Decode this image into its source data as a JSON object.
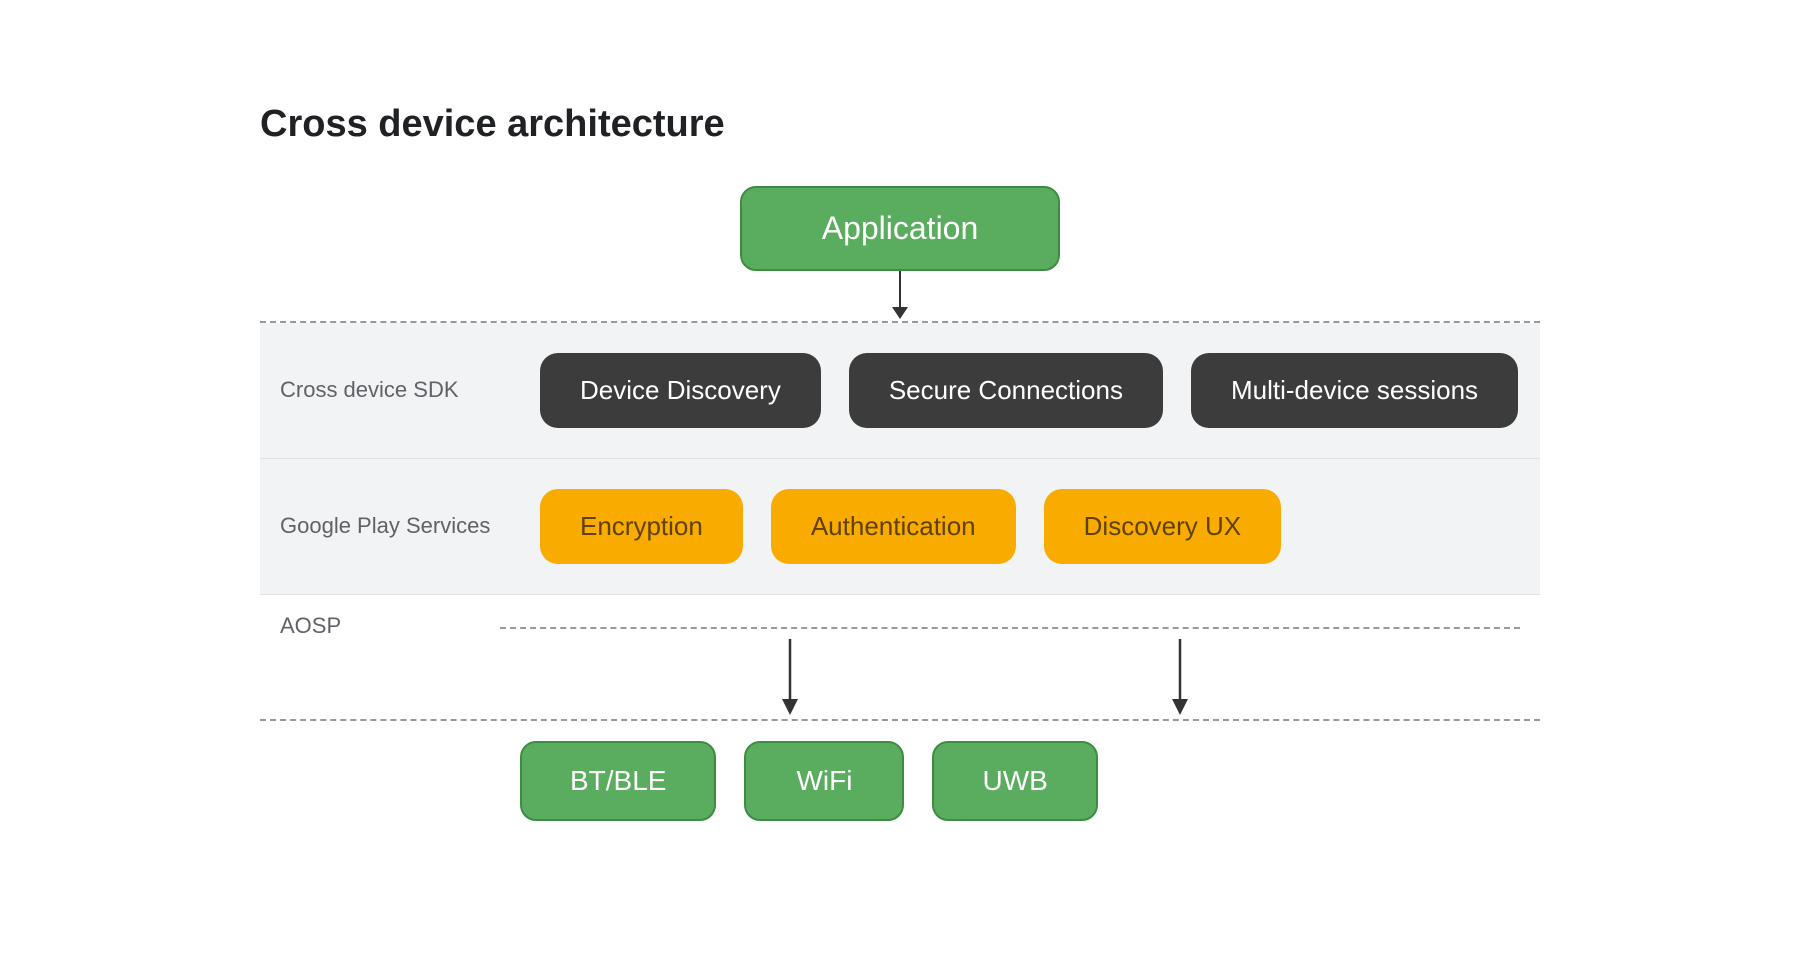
{
  "title": "Cross device architecture",
  "diagram": {
    "application_box": "Application",
    "sdk_label": "Cross device SDK",
    "sdk_items": [
      "Device Discovery",
      "Secure Connections",
      "Multi-device sessions"
    ],
    "play_label": "Google Play Services",
    "play_items": [
      "Encryption",
      "Authentication",
      "Discovery UX"
    ],
    "aosp_label": "AOSP",
    "bottom_items": [
      "BT/BLE",
      "WiFi",
      "UWB"
    ]
  },
  "colors": {
    "green_bg": "#5aad5e",
    "green_border": "#3d8c41",
    "dark_box": "#3c3c3c",
    "yellow_box": "#f9ab00",
    "gray_band": "#f1f3f4"
  }
}
